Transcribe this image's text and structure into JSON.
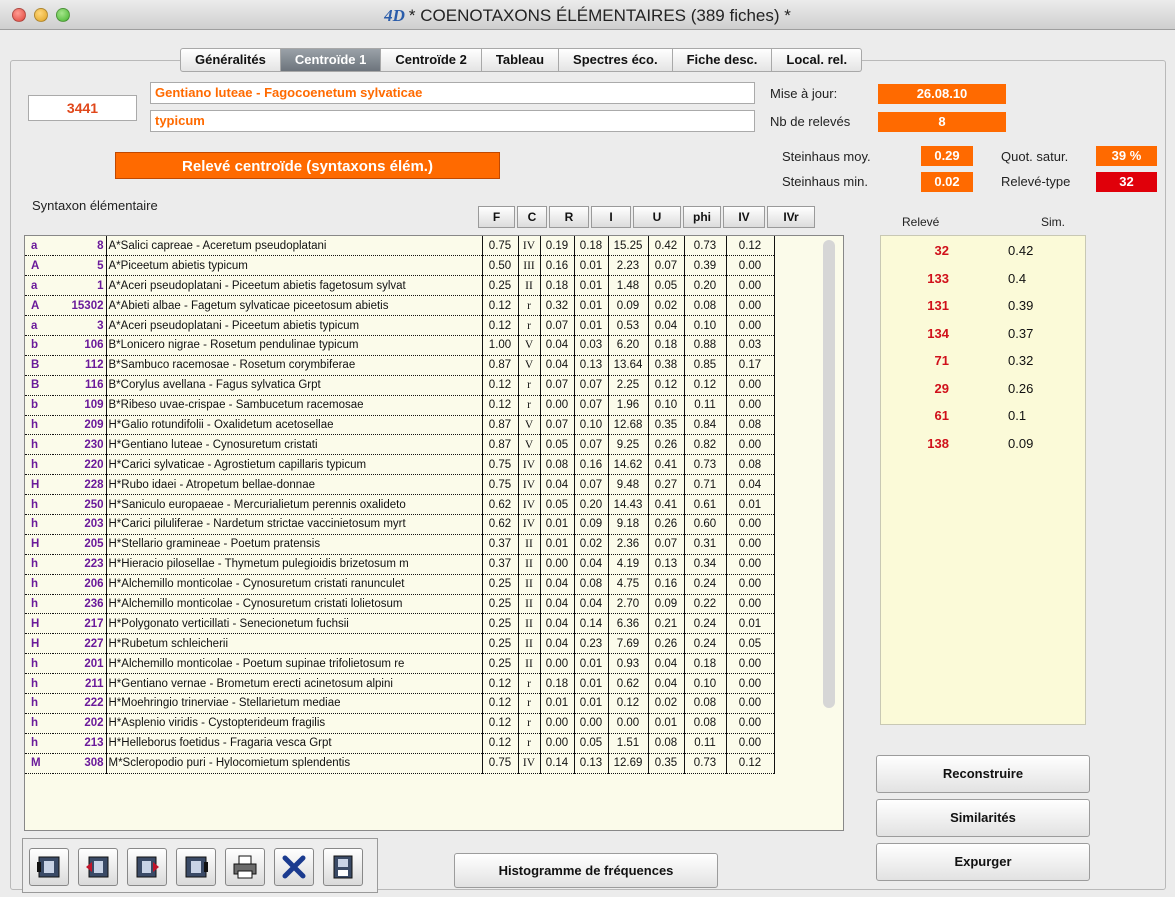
{
  "window": {
    "app_logo": "4D",
    "title": "* COENOTAXONS ÉLÉMENTAIRES (389 fiches) *"
  },
  "tabs": [
    {
      "label": "Généralités",
      "active": false
    },
    {
      "label": "Centroïde 1",
      "active": true
    },
    {
      "label": "Centroïde 2",
      "active": false
    },
    {
      "label": "Tableau",
      "active": false
    },
    {
      "label": "Spectres éco.",
      "active": false
    },
    {
      "label": "Fiche desc.",
      "active": false
    },
    {
      "label": "Local. rel.",
      "active": false
    }
  ],
  "record": {
    "code": "3441",
    "name_line1": "Gentiano luteae - Fagocoenetum sylvaticae",
    "name_line2": "typicum"
  },
  "meta": {
    "maj_label": "Mise à jour:",
    "maj_value": "26.08.10",
    "nb_label": "Nb de relevés",
    "nb_value": "8"
  },
  "stats": {
    "stein_moy_label": "Steinhaus moy.",
    "stein_moy_value": "0.29",
    "quot_label": "Quot. satur.",
    "quot_value": "39 %",
    "stein_min_label": "Steinhaus min.",
    "stein_min_value": "0.02",
    "releve_type_label": "Relevé-type",
    "releve_type_value": "32"
  },
  "centroide_button": "Relevé centroïde (syntaxons élém.)",
  "table": {
    "section_label": "Syntaxon élémentaire",
    "headers": [
      "F",
      "C",
      "R",
      "I",
      "U",
      "phi",
      "IV",
      "IVr"
    ],
    "rows": [
      [
        "a",
        "8",
        "A*Salici capreae - Aceretum pseudoplatani",
        "0.75",
        "IV",
        "0.19",
        "0.18",
        "15.25",
        "0.42",
        "0.73",
        "0.12"
      ],
      [
        "A",
        "5",
        "A*Piceetum abietis typicum",
        "0.50",
        "III",
        "0.16",
        "0.01",
        "2.23",
        "0.07",
        "0.39",
        "0.00"
      ],
      [
        "a",
        "1",
        "A*Aceri pseudoplatani - Piceetum abietis fagetosum sylvat",
        "0.25",
        "II",
        "0.18",
        "0.01",
        "1.48",
        "0.05",
        "0.20",
        "0.00"
      ],
      [
        "A",
        "15302",
        "A*Abieti albae - Fagetum sylvaticae piceetosum abietis",
        "0.12",
        "r",
        "0.32",
        "0.01",
        "0.09",
        "0.02",
        "0.08",
        "0.00"
      ],
      [
        "a",
        "3",
        "A*Aceri pseudoplatani - Piceetum abietis typicum",
        "0.12",
        "r",
        "0.07",
        "0.01",
        "0.53",
        "0.04",
        "0.10",
        "0.00"
      ],
      [
        "b",
        "106",
        "B*Lonicero nigrae - Rosetum pendulinae typicum",
        "1.00",
        "V",
        "0.04",
        "0.03",
        "6.20",
        "0.18",
        "0.88",
        "0.03"
      ],
      [
        "B",
        "112",
        "B*Sambuco racemosae - Rosetum corymbiferae",
        "0.87",
        "V",
        "0.04",
        "0.13",
        "13.64",
        "0.38",
        "0.85",
        "0.17"
      ],
      [
        "B",
        "116",
        "B*Corylus avellana - Fagus sylvatica Grpt",
        "0.12",
        "r",
        "0.07",
        "0.07",
        "2.25",
        "0.12",
        "0.12",
        "0.00"
      ],
      [
        "b",
        "109",
        "B*Ribeso uvae-crispae - Sambucetum racemosae",
        "0.12",
        "r",
        "0.00",
        "0.07",
        "1.96",
        "0.10",
        "0.11",
        "0.00"
      ],
      [
        "h",
        "209",
        "H*Galio rotundifolii - Oxalidetum acetosellae",
        "0.87",
        "V",
        "0.07",
        "0.10",
        "12.68",
        "0.35",
        "0.84",
        "0.08"
      ],
      [
        "h",
        "230",
        "H*Gentiano luteae - Cynosuretum cristati",
        "0.87",
        "V",
        "0.05",
        "0.07",
        "9.25",
        "0.26",
        "0.82",
        "0.00"
      ],
      [
        "h",
        "220",
        "H*Carici sylvaticae - Agrostietum capillaris typicum",
        "0.75",
        "IV",
        "0.08",
        "0.16",
        "14.62",
        "0.41",
        "0.73",
        "0.08"
      ],
      [
        "H",
        "228",
        "H*Rubo idaei - Atropetum bellae-donnae",
        "0.75",
        "IV",
        "0.04",
        "0.07",
        "9.48",
        "0.27",
        "0.71",
        "0.04"
      ],
      [
        "h",
        "250",
        "H*Saniculo europaeae - Mercurialietum perennis oxalideto",
        "0.62",
        "IV",
        "0.05",
        "0.20",
        "14.43",
        "0.41",
        "0.61",
        "0.01"
      ],
      [
        "h",
        "203",
        "H*Carici piluliferae - Nardetum strictae vaccinietosum myrt",
        "0.62",
        "IV",
        "0.01",
        "0.09",
        "9.18",
        "0.26",
        "0.60",
        "0.00"
      ],
      [
        "H",
        "205",
        "H*Stellario gramineae - Poetum pratensis",
        "0.37",
        "II",
        "0.01",
        "0.02",
        "2.36",
        "0.07",
        "0.31",
        "0.00"
      ],
      [
        "h",
        "223",
        "H*Hieracio pilosellae - Thymetum pulegioidis brizetosum m",
        "0.37",
        "II",
        "0.00",
        "0.04",
        "4.19",
        "0.13",
        "0.34",
        "0.00"
      ],
      [
        "h",
        "206",
        "H*Alchemillo monticolae - Cynosuretum cristati ranunculet",
        "0.25",
        "II",
        "0.04",
        "0.08",
        "4.75",
        "0.16",
        "0.24",
        "0.00"
      ],
      [
        "h",
        "236",
        "H*Alchemillo monticolae - Cynosuretum cristati lolietosum",
        "0.25",
        "II",
        "0.04",
        "0.04",
        "2.70",
        "0.09",
        "0.22",
        "0.00"
      ],
      [
        "H",
        "217",
        "H*Polygonato verticillati - Senecionetum fuchsii",
        "0.25",
        "II",
        "0.04",
        "0.14",
        "6.36",
        "0.21",
        "0.24",
        "0.01"
      ],
      [
        "H",
        "227",
        "H*Rubetum schleicherii",
        "0.25",
        "II",
        "0.04",
        "0.23",
        "7.69",
        "0.26",
        "0.24",
        "0.05"
      ],
      [
        "h",
        "201",
        "H*Alchemillo monticolae - Poetum supinae trifolietosum re",
        "0.25",
        "II",
        "0.00",
        "0.01",
        "0.93",
        "0.04",
        "0.18",
        "0.00"
      ],
      [
        "h",
        "211",
        "H*Gentiano vernae - Brometum erecti acinetosum alpini",
        "0.12",
        "r",
        "0.18",
        "0.01",
        "0.62",
        "0.04",
        "0.10",
        "0.00"
      ],
      [
        "h",
        "222",
        "H*Moehringio trinerviae - Stellarietum mediae",
        "0.12",
        "r",
        "0.01",
        "0.01",
        "0.12",
        "0.02",
        "0.08",
        "0.00"
      ],
      [
        "h",
        "202",
        "H*Asplenio viridis - Cystopterideum fragilis",
        "0.12",
        "r",
        "0.00",
        "0.00",
        "0.00",
        "0.01",
        "0.08",
        "0.00"
      ],
      [
        "h",
        "213",
        "H*Helleborus foetidus - Fragaria vesca Grpt",
        "0.12",
        "r",
        "0.00",
        "0.05",
        "1.51",
        "0.08",
        "0.11",
        "0.00"
      ],
      [
        "M",
        "308",
        "M*Scleropodio puri - Hylocomietum splendentis",
        "0.75",
        "IV",
        "0.14",
        "0.13",
        "12.69",
        "0.35",
        "0.73",
        "0.12"
      ]
    ]
  },
  "similarity": {
    "col_releve": "Relevé",
    "col_sim": "Sim.",
    "rows": [
      [
        "32",
        "0.42"
      ],
      [
        "133",
        "0.4"
      ],
      [
        "131",
        "0.39"
      ],
      [
        "134",
        "0.37"
      ],
      [
        "71",
        "0.32"
      ],
      [
        "29",
        "0.26"
      ],
      [
        "61",
        "0.1"
      ],
      [
        "138",
        "0.09"
      ]
    ]
  },
  "buttons": {
    "reconstruire": "Reconstruire",
    "similarites": "Similarités",
    "expurger": "Expurger",
    "histogramme": "Histogramme de fréquences"
  },
  "toolbar_icons": [
    "first-record-icon",
    "previous-record-icon",
    "next-record-icon",
    "last-record-icon",
    "print-icon",
    "delete-icon",
    "save-icon"
  ],
  "colors": {
    "orange": "#ff6a00",
    "red": "#e0000a",
    "purple_code": "#6a1a9a",
    "panel_bg": "#fbfad8"
  }
}
